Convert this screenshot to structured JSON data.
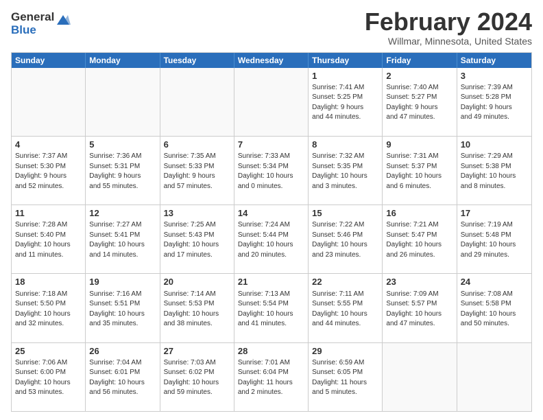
{
  "logo": {
    "general": "General",
    "blue": "Blue"
  },
  "title": "February 2024",
  "location": "Willmar, Minnesota, United States",
  "weekdays": [
    "Sunday",
    "Monday",
    "Tuesday",
    "Wednesday",
    "Thursday",
    "Friday",
    "Saturday"
  ],
  "rows": [
    [
      {
        "day": "",
        "info": ""
      },
      {
        "day": "",
        "info": ""
      },
      {
        "day": "",
        "info": ""
      },
      {
        "day": "",
        "info": ""
      },
      {
        "day": "1",
        "info": "Sunrise: 7:41 AM\nSunset: 5:25 PM\nDaylight: 9 hours\nand 44 minutes."
      },
      {
        "day": "2",
        "info": "Sunrise: 7:40 AM\nSunset: 5:27 PM\nDaylight: 9 hours\nand 47 minutes."
      },
      {
        "day": "3",
        "info": "Sunrise: 7:39 AM\nSunset: 5:28 PM\nDaylight: 9 hours\nand 49 minutes."
      }
    ],
    [
      {
        "day": "4",
        "info": "Sunrise: 7:37 AM\nSunset: 5:30 PM\nDaylight: 9 hours\nand 52 minutes."
      },
      {
        "day": "5",
        "info": "Sunrise: 7:36 AM\nSunset: 5:31 PM\nDaylight: 9 hours\nand 55 minutes."
      },
      {
        "day": "6",
        "info": "Sunrise: 7:35 AM\nSunset: 5:33 PM\nDaylight: 9 hours\nand 57 minutes."
      },
      {
        "day": "7",
        "info": "Sunrise: 7:33 AM\nSunset: 5:34 PM\nDaylight: 10 hours\nand 0 minutes."
      },
      {
        "day": "8",
        "info": "Sunrise: 7:32 AM\nSunset: 5:35 PM\nDaylight: 10 hours\nand 3 minutes."
      },
      {
        "day": "9",
        "info": "Sunrise: 7:31 AM\nSunset: 5:37 PM\nDaylight: 10 hours\nand 6 minutes."
      },
      {
        "day": "10",
        "info": "Sunrise: 7:29 AM\nSunset: 5:38 PM\nDaylight: 10 hours\nand 8 minutes."
      }
    ],
    [
      {
        "day": "11",
        "info": "Sunrise: 7:28 AM\nSunset: 5:40 PM\nDaylight: 10 hours\nand 11 minutes."
      },
      {
        "day": "12",
        "info": "Sunrise: 7:27 AM\nSunset: 5:41 PM\nDaylight: 10 hours\nand 14 minutes."
      },
      {
        "day": "13",
        "info": "Sunrise: 7:25 AM\nSunset: 5:43 PM\nDaylight: 10 hours\nand 17 minutes."
      },
      {
        "day": "14",
        "info": "Sunrise: 7:24 AM\nSunset: 5:44 PM\nDaylight: 10 hours\nand 20 minutes."
      },
      {
        "day": "15",
        "info": "Sunrise: 7:22 AM\nSunset: 5:46 PM\nDaylight: 10 hours\nand 23 minutes."
      },
      {
        "day": "16",
        "info": "Sunrise: 7:21 AM\nSunset: 5:47 PM\nDaylight: 10 hours\nand 26 minutes."
      },
      {
        "day": "17",
        "info": "Sunrise: 7:19 AM\nSunset: 5:48 PM\nDaylight: 10 hours\nand 29 minutes."
      }
    ],
    [
      {
        "day": "18",
        "info": "Sunrise: 7:18 AM\nSunset: 5:50 PM\nDaylight: 10 hours\nand 32 minutes."
      },
      {
        "day": "19",
        "info": "Sunrise: 7:16 AM\nSunset: 5:51 PM\nDaylight: 10 hours\nand 35 minutes."
      },
      {
        "day": "20",
        "info": "Sunrise: 7:14 AM\nSunset: 5:53 PM\nDaylight: 10 hours\nand 38 minutes."
      },
      {
        "day": "21",
        "info": "Sunrise: 7:13 AM\nSunset: 5:54 PM\nDaylight: 10 hours\nand 41 minutes."
      },
      {
        "day": "22",
        "info": "Sunrise: 7:11 AM\nSunset: 5:55 PM\nDaylight: 10 hours\nand 44 minutes."
      },
      {
        "day": "23",
        "info": "Sunrise: 7:09 AM\nSunset: 5:57 PM\nDaylight: 10 hours\nand 47 minutes."
      },
      {
        "day": "24",
        "info": "Sunrise: 7:08 AM\nSunset: 5:58 PM\nDaylight: 10 hours\nand 50 minutes."
      }
    ],
    [
      {
        "day": "25",
        "info": "Sunrise: 7:06 AM\nSunset: 6:00 PM\nDaylight: 10 hours\nand 53 minutes."
      },
      {
        "day": "26",
        "info": "Sunrise: 7:04 AM\nSunset: 6:01 PM\nDaylight: 10 hours\nand 56 minutes."
      },
      {
        "day": "27",
        "info": "Sunrise: 7:03 AM\nSunset: 6:02 PM\nDaylight: 10 hours\nand 59 minutes."
      },
      {
        "day": "28",
        "info": "Sunrise: 7:01 AM\nSunset: 6:04 PM\nDaylight: 11 hours\nand 2 minutes."
      },
      {
        "day": "29",
        "info": "Sunrise: 6:59 AM\nSunset: 6:05 PM\nDaylight: 11 hours\nand 5 minutes."
      },
      {
        "day": "",
        "info": ""
      },
      {
        "day": "",
        "info": ""
      }
    ]
  ]
}
